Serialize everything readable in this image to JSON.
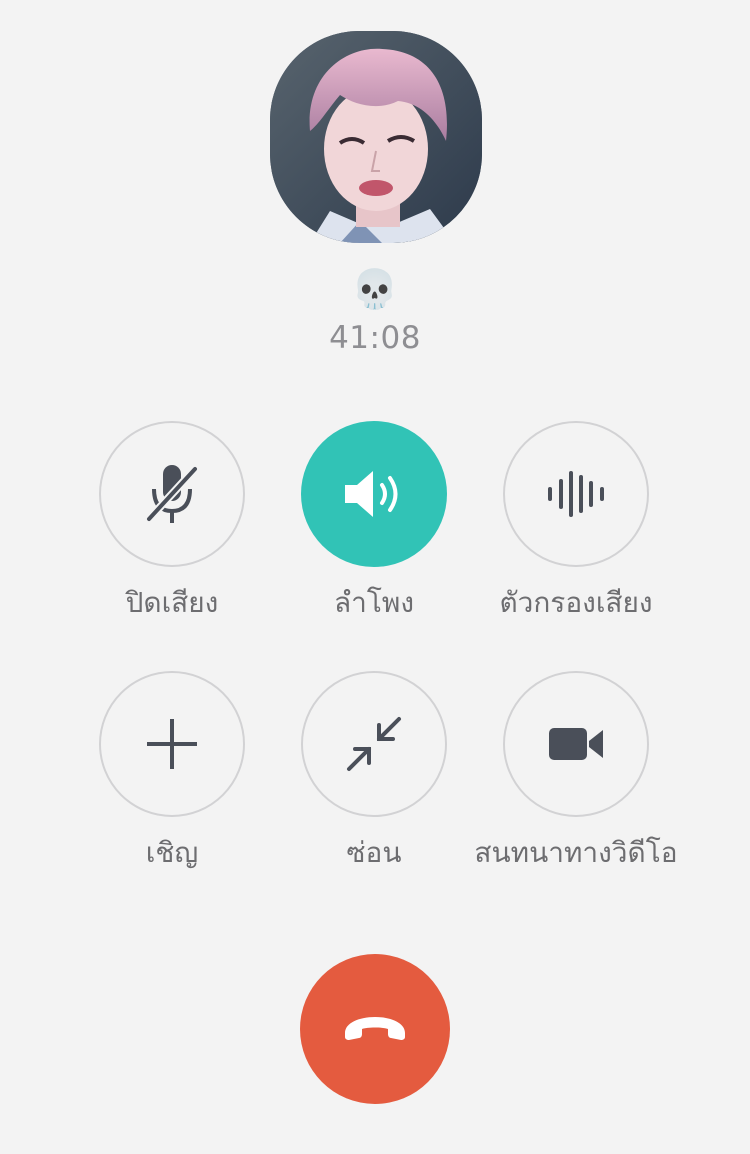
{
  "caller": {
    "name": "💀",
    "duration": "41:08"
  },
  "controls": {
    "mute": {
      "label": "ปิดเสียง",
      "icon": "microphone-off-icon",
      "active": false
    },
    "speaker": {
      "label": "ลำโพง",
      "icon": "speaker-icon",
      "active": true
    },
    "noise_filter": {
      "label": "ตัวกรองเสียง",
      "icon": "sound-wave-icon",
      "active": false
    },
    "invite": {
      "label": "เชิญ",
      "icon": "plus-icon",
      "active": false
    },
    "minimize": {
      "label": "ซ่อน",
      "icon": "minimize-arrows-icon",
      "active": false
    },
    "video": {
      "label": "สนทนาทางวิดีโอ",
      "icon": "video-camera-icon",
      "active": false
    }
  },
  "end_call": {
    "icon": "hang-up-icon"
  },
  "colors": {
    "background": "#f3f3f3",
    "accent": "#31c3b6",
    "end_call": "#e45b3f",
    "icon": "#4a4f59"
  }
}
